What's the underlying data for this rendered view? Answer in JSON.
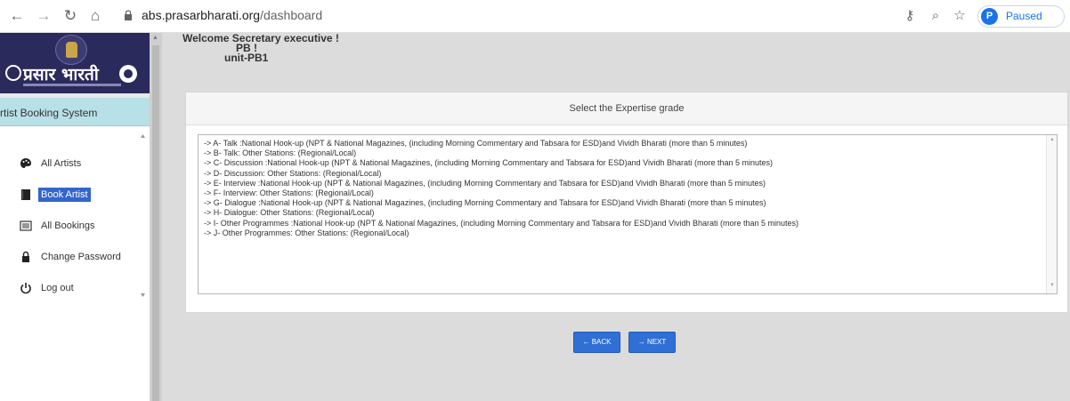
{
  "browser": {
    "url_host": "abs.prasarbharati.org",
    "url_path": "/dashboard",
    "profile_initial": "P",
    "profile_status": "Paused",
    "icons": [
      "back-arrow-icon",
      "forward-arrow-icon",
      "reload-icon",
      "home-icon",
      "lock-icon",
      "key-icon",
      "zoom-icon",
      "star-icon"
    ]
  },
  "sidebar": {
    "brand_name": "प्रसार भारती",
    "system_title": "rtist Booking System",
    "items": [
      {
        "label": "All Artists",
        "icon": "palette-icon",
        "active": false
      },
      {
        "label": "Book Artist",
        "icon": "book-icon",
        "active": true
      },
      {
        "label": "All Bookings",
        "icon": "list-icon",
        "active": false
      },
      {
        "label": "Change Password",
        "icon": "lock-icon",
        "active": false
      },
      {
        "label": "Log out",
        "icon": "power-icon",
        "active": false
      }
    ]
  },
  "welcome": {
    "line1": "Welcome Secretary executive !",
    "line2": "PB !",
    "line3": "unit-PB1"
  },
  "panel": {
    "title": "Select the Expertise grade",
    "options": [
      "-> A- Talk :National Hook-up (NPT & National Magazines, (including Morning Commentary and Tabsara for ESD)and Vividh Bharati (more than 5 minutes)",
      "-> B- Talk: Other Stations: (Regional/Local)",
      "-> C- Discussion :National Hook-up (NPT & National Magazines, (including Morning Commentary and Tabsara for ESD)and Vividh Bharati (more than 5 minutes)",
      "-> D- Discussion: Other Stations: (Regional/Local)",
      "-> E- Interview :National Hook-up (NPT & National Magazines, (including Morning Commentary and Tabsara for ESD)and Vividh Bharati (more than 5 minutes)",
      "-> F- Interview: Other Stations: (Regional/Local)",
      "-> G- Dialogue :National Hook-up (NPT & National Magazines, (including Morning Commentary and Tabsara for ESD)and Vividh Bharati (more than 5 minutes)",
      "-> H- Dialogue: Other Stations: (Regional/Local)",
      "-> I- Other Programmes :National Hook-up (NPT & National Magazines, (including Morning Commentary and Tabsara for ESD)and Vividh Bharati (more than 5 minutes)",
      "-> J- Other Programmes: Other Stations: (Regional/Local)"
    ]
  },
  "actions": {
    "back_label": "← BACK",
    "next_label": "→ NEXT"
  },
  "colors": {
    "brand": "#2b2a5c",
    "sidebar_band": "#b8e0e7",
    "primary_button": "#2f6fd6",
    "active_item": "#3366cc"
  }
}
